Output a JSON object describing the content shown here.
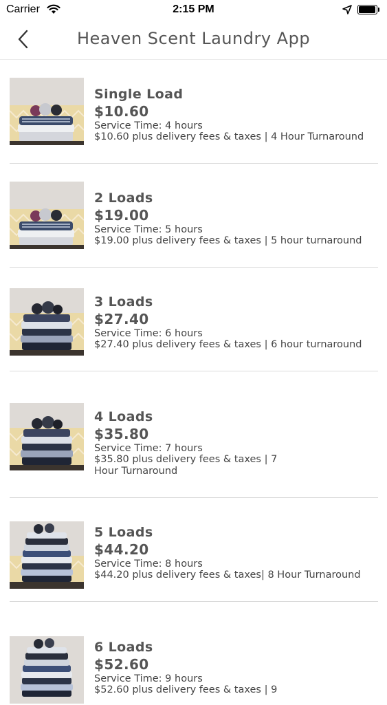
{
  "status_bar": {
    "carrier": "Carrier",
    "time": "2:15 PM"
  },
  "nav": {
    "title": "Heaven Scent Laundry App"
  },
  "items": [
    {
      "name": "Single Load",
      "price": "$10.60",
      "service": "Service Time: 4 hours",
      "desc": "$10.60 plus delivery fees & taxes | 4 Hour Turnaround"
    },
    {
      "name": "2 Loads",
      "price": "$19.00",
      "service": "Service Time: 5 hours",
      "desc": "$19.00 plus delivery fees & taxes | 5 hour turnaround"
    },
    {
      "name": "3 Loads",
      "price": "$27.40",
      "service": "Service Time: 6 hours",
      "desc": "$27.40 plus delivery fees & taxes | 6 hour turnaround"
    },
    {
      "name": "4 Loads",
      "price": "$35.80",
      "service": "Service Time: 7 hours",
      "desc": "$35.80 plus delivery fees & taxes | 7 Hour Turnaround"
    },
    {
      "name": "5 Loads",
      "price": "$44.20",
      "service": "Service Time: 8 hours",
      "desc": "$44.20 plus delivery fees & taxes| 8 Hour Turnaround"
    },
    {
      "name": "6 Loads",
      "price": "$52.60",
      "service": "Service Time: 9 hours",
      "desc": "$52.60 plus delivery fees & taxes | 9"
    }
  ]
}
